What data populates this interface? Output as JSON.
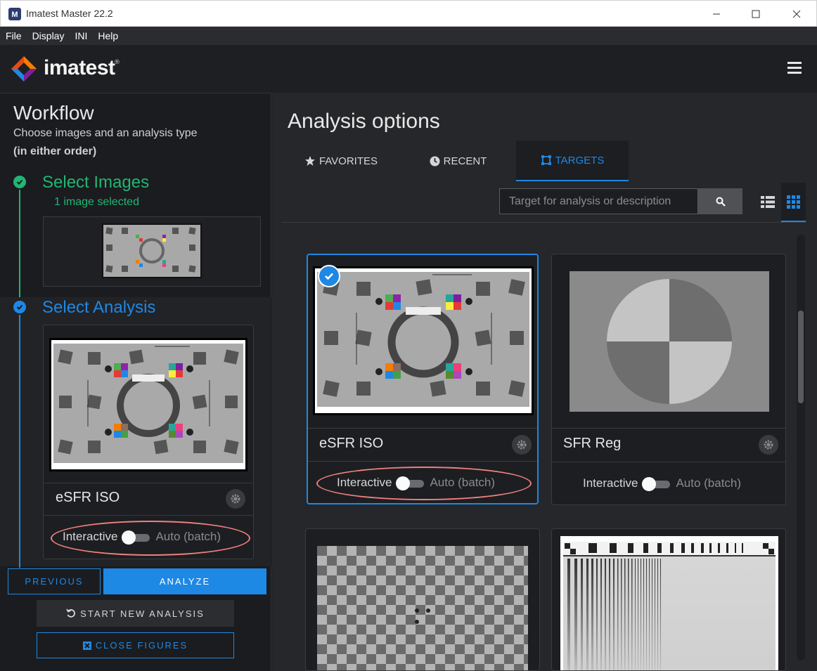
{
  "window": {
    "title": "Imatest Master 22.2"
  },
  "menu": [
    "File",
    "Display",
    "INI",
    "Help"
  ],
  "brand": {
    "name": "imatest",
    "reg": "®"
  },
  "workflow": {
    "title": "Workflow",
    "subtitle": "Choose images and an analysis type",
    "subtitle2": "(in either order)",
    "step1": {
      "label": "Select Images",
      "status": "1 image selected"
    },
    "step2": {
      "label": "Select Analysis",
      "card": {
        "name": "eSFR ISO",
        "toggle_left": "Interactive",
        "toggle_right": "Auto (batch)"
      }
    },
    "buttons": {
      "previous": "PREVIOUS",
      "analyze": "ANALYZE",
      "start_new": "START NEW ANALYSIS",
      "close_figures": "CLOSE FIGURES"
    }
  },
  "analysis": {
    "title": "Analysis options",
    "tabs": [
      {
        "label": "FAVORITES",
        "icon": "star-icon"
      },
      {
        "label": "RECENT",
        "icon": "clock-icon"
      },
      {
        "label": "TARGETS",
        "icon": "target-icon",
        "active": true
      }
    ],
    "search": {
      "placeholder": "Target for analysis or description",
      "value": ""
    },
    "cards": [
      {
        "name": "eSFR ISO",
        "toggle_left": "Interactive",
        "toggle_right": "Auto (batch)",
        "selected": true
      },
      {
        "name": "SFR Reg",
        "toggle_left": "Interactive",
        "toggle_right": "Auto (batch)",
        "selected": false
      },
      {
        "name": "",
        "selected": false
      },
      {
        "name": "",
        "selected": false
      }
    ]
  },
  "colors": {
    "accent": "#1e88e5",
    "success": "#22b573",
    "highlight": "#f08080"
  }
}
